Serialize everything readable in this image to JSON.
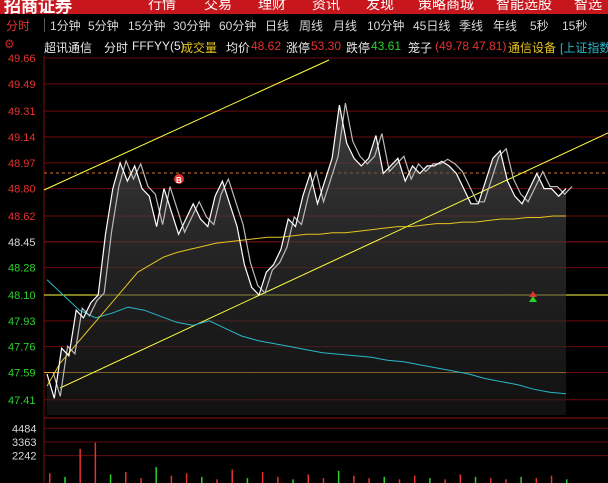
{
  "app": {
    "brand": "招商证券",
    "nav": [
      "行情",
      "交易",
      "理财",
      "资讯",
      "发现",
      "策略商城",
      "智能选股",
      "智选"
    ],
    "icon": "gear-icon"
  },
  "tabs": {
    "items": [
      "分时",
      "1分钟",
      "5分钟",
      "15分钟",
      "30分钟",
      "60分钟",
      "日线",
      "周线",
      "月线",
      "10分钟",
      "45日线",
      "季线",
      "年线",
      "5秒",
      "15秒"
    ],
    "active": "分时"
  },
  "info": {
    "stock_name": "超讯通信",
    "mode": "分时",
    "indicator": "FFFYY(5)",
    "volume_label": "成交量",
    "avg_label": "均价",
    "avg_value": "48.62",
    "limit_up_label": "涨停",
    "limit_up_value": "53.30",
    "limit_down_label": "跌停",
    "limit_down_value": "43.61",
    "cage_label": "笼子",
    "cage_value": "(49.78 47.81)",
    "sector": "通信设备",
    "exchange_link": "[上证指数"
  },
  "colors": {
    "up": "#e6312e",
    "down": "#2bd12b",
    "price_line": "#ffffff",
    "avg_line": "#e6c320",
    "index_line": "#27b8c8",
    "channel_line": "#ffff40",
    "grid": "#6a0b0b"
  },
  "chart_data": {
    "type": "line",
    "y_ticks": [
      "49.66",
      "49.49",
      "49.31",
      "49.14",
      "48.97",
      "48.80",
      "48.62",
      "48.45",
      "48.28",
      "48.10",
      "47.93",
      "47.76",
      "47.59",
      "47.41"
    ],
    "ylim": [
      47.31,
      49.66
    ],
    "prev_close": 48.45,
    "volume_ticks": [
      "4484",
      "3363",
      "2242"
    ],
    "volume_ylim": [
      0,
      5000
    ],
    "marker_label": "B",
    "series": [
      {
        "values": [
          47.58,
          47.42,
          47.75,
          47.7,
          48.0,
          47.95,
          48.05,
          48.1,
          48.5,
          48.8,
          48.97,
          48.85,
          48.95,
          48.8,
          48.75,
          48.55,
          48.8,
          48.65,
          48.5,
          48.6,
          48.7,
          48.6,
          48.55,
          48.75,
          48.85,
          48.7,
          48.55,
          48.3,
          48.15,
          48.1,
          48.25,
          48.3,
          48.4,
          48.6,
          48.55,
          48.75,
          48.9,
          48.7,
          48.85,
          49.0,
          49.35,
          49.1,
          49.0,
          48.95,
          49.0,
          49.15,
          48.9,
          48.95,
          49.0,
          48.85,
          48.95,
          48.9,
          48.95,
          48.95,
          48.98,
          48.95,
          48.9,
          48.8,
          48.7,
          48.7,
          48.85,
          49.0,
          49.05,
          48.85,
          48.75,
          48.7,
          48.8,
          48.9,
          48.8,
          48.8,
          48.75,
          48.8
        ]
      },
      {
        "values": [
          47.5,
          47.65,
          47.75,
          47.85,
          47.95,
          48.05,
          48.15,
          48.25,
          48.3,
          48.35,
          48.38,
          48.4,
          48.42,
          48.44,
          48.45,
          48.46,
          48.47,
          48.48,
          48.48,
          48.49,
          48.5,
          48.5,
          48.51,
          48.51,
          48.52,
          48.53,
          48.54,
          48.55,
          48.55,
          48.56,
          48.57,
          48.57,
          48.58,
          48.58,
          48.59,
          48.6,
          48.6,
          48.61,
          48.61,
          48.62,
          48.62
        ]
      },
      {
        "values": [
          48.2,
          48.1,
          48.0,
          47.95,
          47.98,
          48.02,
          48.0,
          47.96,
          47.92,
          47.9,
          47.93,
          47.88,
          47.83,
          47.8,
          47.78,
          47.76,
          47.74,
          47.72,
          47.71,
          47.7,
          47.69,
          47.67,
          47.66,
          47.64,
          47.62,
          47.6,
          47.58,
          47.55,
          47.53,
          47.51,
          47.48,
          47.46,
          47.45
        ]
      }
    ],
    "volume_values": [
      800,
      500,
      2800,
      3300,
      700,
      900,
      400,
      1300,
      600,
      800,
      500,
      300,
      1100,
      400,
      900,
      500,
      300,
      700,
      400,
      1000,
      600,
      400,
      500,
      300,
      600,
      400,
      300,
      700,
      500,
      400,
      300,
      500,
      400,
      600,
      300
    ]
  }
}
